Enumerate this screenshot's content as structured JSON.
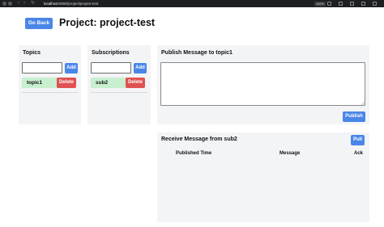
{
  "browser": {
    "url_host": "localhost",
    "url_path": ":8080/project/project-test",
    "zoom": "110%"
  },
  "header": {
    "go_back": "Go Back",
    "title": "Project: project-test"
  },
  "topics": {
    "title": "Topics",
    "input_value": "",
    "add_label": "Add",
    "items": [
      {
        "label": "topic1",
        "delete_label": "Delete"
      }
    ]
  },
  "subscriptions": {
    "title": "Subscriptions",
    "input_value": "",
    "add_label": "Add",
    "items": [
      {
        "label": "sub2",
        "delete_label": "Delete"
      }
    ]
  },
  "publish": {
    "title": "Publish Message to topic1",
    "message_value": "",
    "publish_label": "Publish"
  },
  "receive": {
    "title": "Receive Message from sub2",
    "pull_label": "Pull",
    "columns": [
      "Published Time",
      "Message",
      "Ack"
    ]
  }
}
